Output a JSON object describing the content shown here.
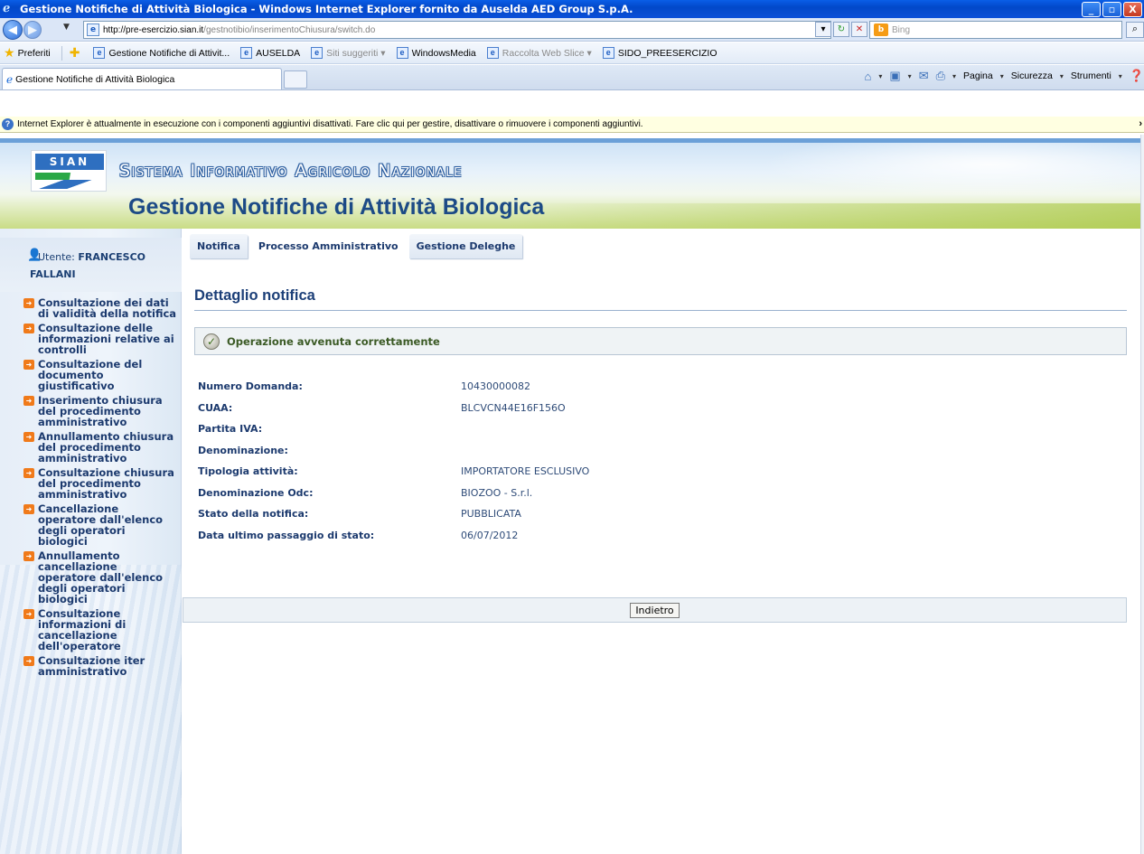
{
  "window": {
    "title": "Gestione Notifiche di Attività Biologica - Windows Internet Explorer fornito da Auselda AED Group S.p.A.",
    "min_label": "_",
    "max_label": "▫",
    "close_label": "X"
  },
  "address": {
    "url_host": "http://pre-esercizio.sian.it",
    "url_path": "/gestnotibio/inserimentoChiusura/switch.do",
    "search_placeholder": "Bing"
  },
  "favorites": {
    "label": "Preferiti",
    "items": [
      {
        "label": "Gestione Notifiche di Attivit...",
        "dim": false
      },
      {
        "label": "AUSELDA",
        "dim": false
      },
      {
        "label": "Siti suggeriti ▾",
        "dim": true
      },
      {
        "label": "WindowsMedia",
        "dim": false
      },
      {
        "label": "Raccolta Web Slice ▾",
        "dim": true
      },
      {
        "label": "SIDO_PREESERCIZIO",
        "dim": false
      }
    ]
  },
  "tabs": {
    "active_label": "Gestione Notifiche di Attività Biologica"
  },
  "commandbar": {
    "page": "Pagina",
    "security": "Sicurezza",
    "tools": "Strumenti"
  },
  "infobar": {
    "text": "Internet Explorer è attualmente in esecuzione con i componenti aggiuntivi disattivati. Fare clic qui per gestire, disattivare o rimuovere i componenti aggiuntivi."
  },
  "header": {
    "logo_text": "SIAN",
    "system_name": "Sistema Informativo Agricolo Nazionale",
    "app_title": "Gestione Notifiche di Attività Biologica"
  },
  "user": {
    "label": "Utente:",
    "first_name": "FRANCESCO",
    "last_name": "FALLANI"
  },
  "sidebar": {
    "items": [
      {
        "label": "Consultazione dei dati di validità della notifica"
      },
      {
        "label": "Consultazione delle informazioni relative ai controlli"
      },
      {
        "label": "Consultazione del documento giustificativo"
      },
      {
        "label": "Inserimento chiusura del procedimento amministrativo"
      },
      {
        "label": "Annullamento chiusura del procedimento amministrativo"
      },
      {
        "label": "Consultazione chiusura del procedimento amministrativo"
      },
      {
        "label": "Cancellazione operatore dall'elenco degli operatori biologici"
      },
      {
        "label": "Annullamento cancellazione operatore dall'elenco degli operatori biologici"
      },
      {
        "label": "Consultazione informazioni di cancellazione dell'operatore"
      },
      {
        "label": "Consultazione iter amministrativo"
      }
    ]
  },
  "topnav": {
    "items": [
      {
        "label": "Notifica",
        "boxed": true
      },
      {
        "label": "Processo Amministrativo",
        "boxed": false
      },
      {
        "label": "Gestione Deleghe",
        "boxed": true
      }
    ]
  },
  "main": {
    "page_title": "Dettaglio notifica",
    "success_message": "Operazione avvenuta correttamente",
    "fields": [
      {
        "label": "Numero Domanda:",
        "value": "10430000082"
      },
      {
        "label": "CUAA:",
        "value": "BLCVCN44E16F156O"
      },
      {
        "label": "Partita IVA:",
        "value": ""
      },
      {
        "label": "Denominazione:",
        "value": ""
      },
      {
        "label": "Tipologia attività:",
        "value": "IMPORTATORE ESCLUSIVO"
      },
      {
        "label": "Denominazione Odc:",
        "value": "BIOZOO - S.r.l."
      },
      {
        "label": "Stato della notifica:",
        "value": "PUBBLICATA"
      },
      {
        "label": "Data ultimo passaggio di stato:",
        "value": "06/07/2012"
      }
    ],
    "back_button": "Indietro"
  }
}
